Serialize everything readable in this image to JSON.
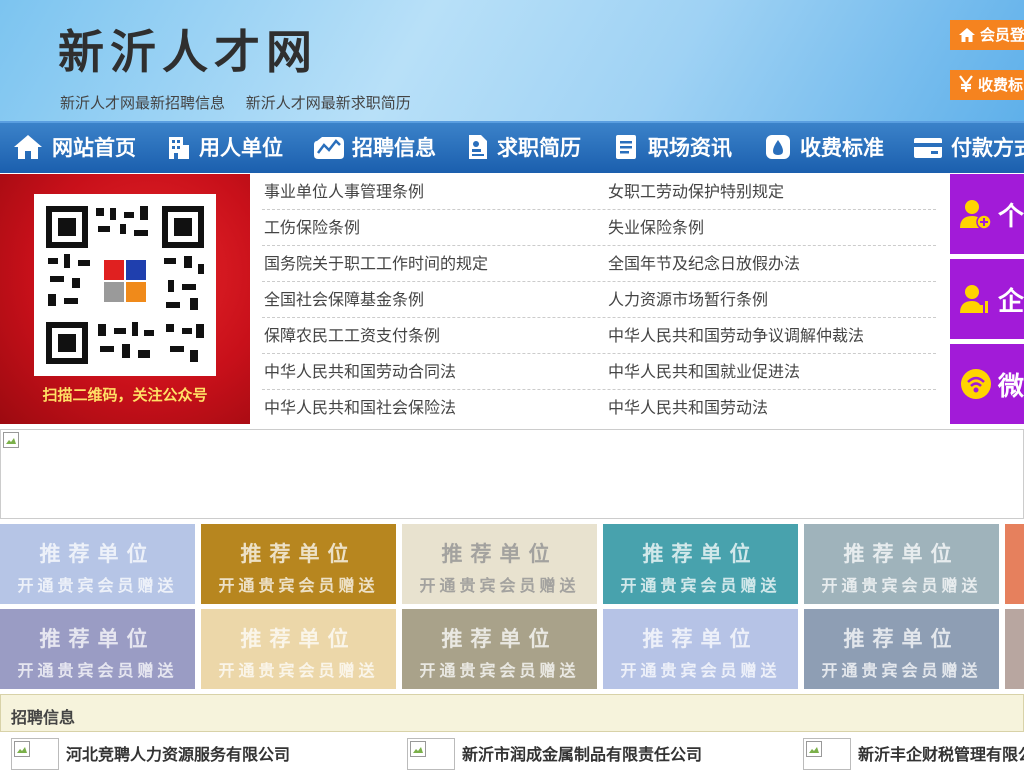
{
  "header": {
    "site_title": "新沂人才网",
    "sub_links": [
      "新沂人才网最新招聘信息",
      "新沂人才网最新求职简历"
    ],
    "member_login": "会员登",
    "fee_label": "收费标"
  },
  "nav": {
    "items": [
      {
        "label": "网站首页",
        "icon": "home-icon"
      },
      {
        "label": "用人单位",
        "icon": "building-icon"
      },
      {
        "label": "招聘信息",
        "icon": "chart-icon"
      },
      {
        "label": "求职简历",
        "icon": "resume-icon"
      },
      {
        "label": "职场资讯",
        "icon": "news-icon"
      },
      {
        "label": "收费标准",
        "icon": "money-bag-icon"
      },
      {
        "label": "付款方式",
        "icon": "card-icon"
      }
    ]
  },
  "qr": {
    "caption": "扫描二维码，关注公众号"
  },
  "laws": {
    "rows": [
      [
        "事业单位人事管理条例",
        "女职工劳动保护特别规定"
      ],
      [
        "工伤保险条例",
        "失业保险条例"
      ],
      [
        "国务院关于职工工作时间的规定",
        "全国年节及纪念日放假办法"
      ],
      [
        "全国社会保障基金条例",
        "人力资源市场暂行条例"
      ],
      [
        "保障农民工工资支付条例",
        "中华人民共和国劳动争议调解仲裁法"
      ],
      [
        "中华人民共和国劳动合同法",
        "中华人民共和国就业促进法"
      ],
      [
        "中华人民共和国社会保险法",
        "中华人民共和国劳动法"
      ]
    ]
  },
  "side": {
    "buttons": [
      "个",
      "企",
      "微"
    ]
  },
  "tiles": {
    "title": "推荐单位",
    "subtitle": "开通贵宾会员赠送",
    "colors": [
      [
        "#b6c5e6",
        "#b7861f",
        "#e8e2cf",
        "#48a2ad",
        "#9fb3bb",
        "#e6805d"
      ],
      [
        "#9a9cc4",
        "#ecd7a9",
        "#a9a28a",
        "#b6c3e6",
        "#8e9eb4",
        "#b8a6a0"
      ]
    ]
  },
  "recruit": {
    "heading": "招聘信息",
    "companies": [
      "河北竞聘人力资源服务有限公司",
      "新沂市润成金属制品有限责任公司",
      "新沂丰企财税管理有限公司"
    ]
  }
}
